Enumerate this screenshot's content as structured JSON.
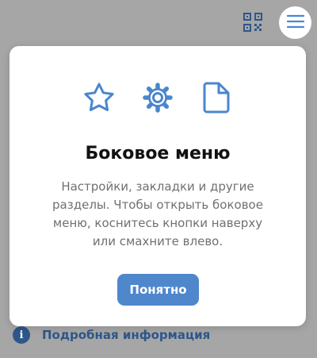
{
  "topbar": {
    "qr_icon": "qr-code-icon",
    "menu_icon": "hamburger-menu-icon"
  },
  "bottom": {
    "info_icon_glyph": "i",
    "info_link": "Подробная информация"
  },
  "dialog": {
    "icons": [
      "star-icon",
      "gear-icon",
      "document-icon"
    ],
    "title": "Боковое меню",
    "body": "Настройки, закладки и другие разделы. Чтобы открыть боковое меню, коснитесь кнопки наверху или смахните влево.",
    "button": "Понятно"
  },
  "colors": {
    "overlay": "#a6a6a6",
    "accent": "#4f87cc",
    "icon_blue": "#4a86cf",
    "link": "#2f568a",
    "text": "#111111",
    "muted_text": "#707070"
  }
}
